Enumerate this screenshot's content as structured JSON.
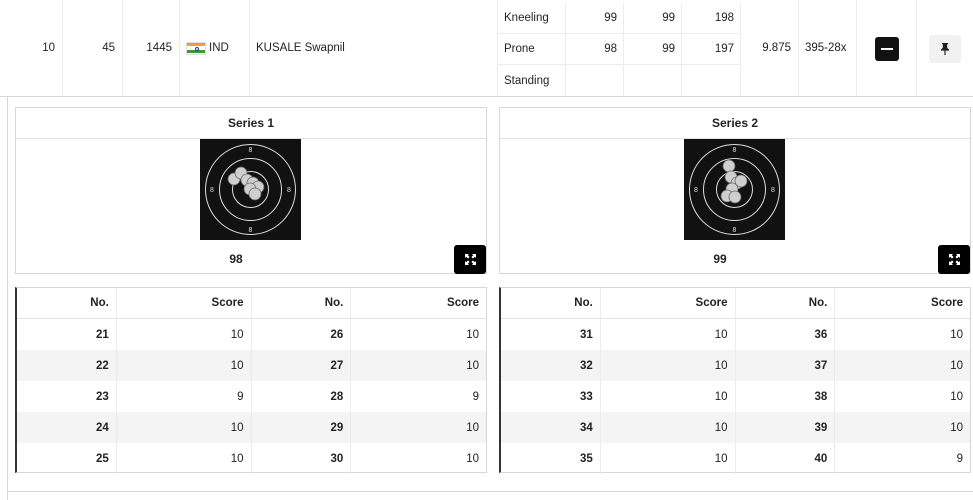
{
  "athlete": {
    "rank": "10",
    "bib": "45",
    "id": "1445",
    "country": "IND",
    "name": "KUSALE Swapnil",
    "inner_tens": "9.875",
    "total": "395-28x",
    "positions": [
      {
        "name": "Kneeling",
        "s1": "99",
        "s2": "99",
        "total": "198"
      },
      {
        "name": "Prone",
        "s1": "98",
        "s2": "99",
        "total": "197"
      },
      {
        "name": "Standing",
        "s1": "",
        "s2": "",
        "total": ""
      }
    ]
  },
  "icons": {
    "collapse": "minus-icon",
    "pin": "pin-icon",
    "expand": "expand-icon",
    "flag": "india-flag-icon"
  },
  "colors": {
    "button_dark": "#111111",
    "target_bg": "#111111",
    "row_stripe": "#f4f4f4"
  },
  "series": [
    {
      "title": "Series 1",
      "total": "98",
      "ring_label": "8",
      "columns": [
        "No.",
        "Score",
        "No.",
        "Score"
      ],
      "rows": [
        [
          "21",
          "10",
          "26",
          "10"
        ],
        [
          "22",
          "10",
          "27",
          "10"
        ],
        [
          "23",
          "9",
          "28",
          "9"
        ],
        [
          "24",
          "10",
          "29",
          "10"
        ],
        [
          "25",
          "10",
          "30",
          "10"
        ]
      ]
    },
    {
      "title": "Series 2",
      "total": "99",
      "ring_label": "8",
      "columns": [
        "No.",
        "Score",
        "No.",
        "Score"
      ],
      "rows": [
        [
          "31",
          "10",
          "36",
          "10"
        ],
        [
          "32",
          "10",
          "37",
          "10"
        ],
        [
          "33",
          "10",
          "38",
          "10"
        ],
        [
          "34",
          "10",
          "39",
          "10"
        ],
        [
          "35",
          "10",
          "40",
          "9"
        ]
      ]
    }
  ]
}
